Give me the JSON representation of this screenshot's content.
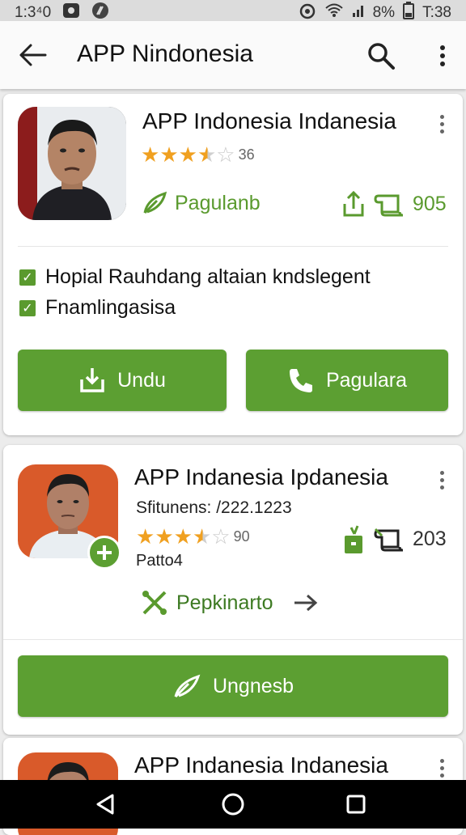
{
  "status_bar": {
    "time_left": "1:3⁴0",
    "battery": "8%",
    "time_right": "T:38",
    "icons": [
      "notification-icon",
      "compass-icon",
      "alarm-icon",
      "wifi-icon",
      "signal-icon",
      "battery-icon"
    ]
  },
  "app_bar": {
    "title": "APP Nindonesia",
    "back_icon": "arrow-left-icon",
    "search_icon": "search-icon",
    "menu_icon": "more-vert-icon"
  },
  "cards": [
    {
      "title": "APP Indonesia Indanesia",
      "rating_count": "36",
      "rating": 3.5,
      "tag_label": "Pagulanb",
      "stat_value": "905",
      "checks": [
        "Hopial Rauhdang altaian kndslegent",
        "Fnamlingasisa"
      ],
      "buttons": [
        "Undu",
        "Pagulara"
      ]
    },
    {
      "title": "APP Indanesia Ipdanesia",
      "subtitle": "Sfitunens: /222.1223",
      "rating_count": "90",
      "rating": 3.5,
      "stat_value": "203",
      "note": "Patto4",
      "link_label": "Pepkinarto",
      "button": "Ungnesb"
    },
    {
      "title": "APP Indanesia Indanesia"
    }
  ],
  "colors": {
    "accent_green": "#5c9f32",
    "star": "#f0a020",
    "nav_bar": "#000000"
  }
}
